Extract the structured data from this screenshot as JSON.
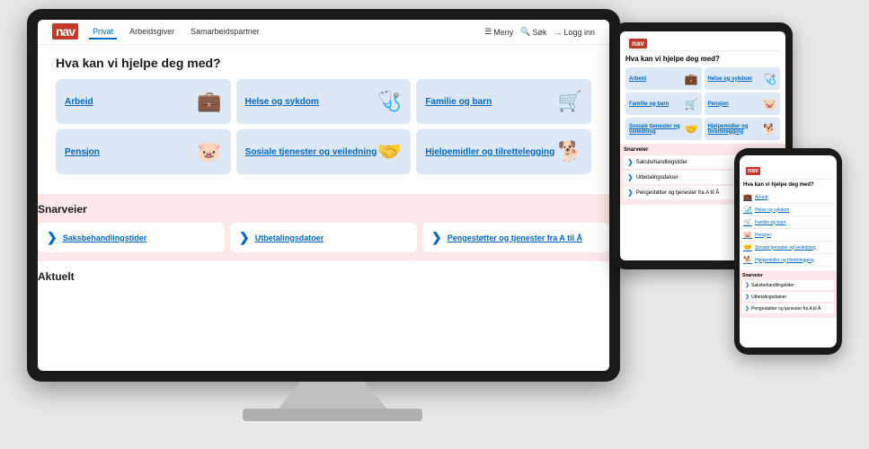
{
  "site": {
    "logo": "nav",
    "tabs": [
      {
        "label": "Privat",
        "active": true
      },
      {
        "label": "Arbeidsgiver",
        "active": false
      },
      {
        "label": "Samarbeidspartner",
        "active": false
      }
    ],
    "actions": [
      {
        "label": "Meny",
        "icon": "menu-icon"
      },
      {
        "label": "Søk",
        "icon": "search-icon"
      },
      {
        "label": "Logg inn",
        "icon": "login-icon"
      }
    ],
    "heading": "Hva kan vi hjelpe deg med?",
    "categories": [
      {
        "label": "Arbeid",
        "icon": "💼"
      },
      {
        "label": "Helse og sykdom",
        "icon": "🩺"
      },
      {
        "label": "Familie og barn",
        "icon": "🛒"
      },
      {
        "label": "Pensjon",
        "icon": "🐷"
      },
      {
        "label": "Sosiale tjenester og veiledning",
        "icon": "🤝"
      },
      {
        "label": "Hjelpemidler og tilrettelegging",
        "icon": "🐕"
      }
    ],
    "shortcuts_heading": "Snarveier",
    "shortcuts": [
      {
        "label": "Saksbehandlingstider"
      },
      {
        "label": "Utbetalingsdatoer"
      },
      {
        "label": "Pengestøtter og tjenester fra A til Å"
      }
    ],
    "aktuelt_heading": "Aktuelt"
  },
  "tablet": {
    "heading": "Hva kan vi hjelpe deg med?",
    "categories": [
      {
        "label": "Arbeid",
        "icon": "💼"
      },
      {
        "label": "Helse og sykdom",
        "icon": "🩺"
      },
      {
        "label": "Familie og barn",
        "icon": "🛒"
      },
      {
        "label": "Pensjon",
        "icon": "🐷"
      },
      {
        "label": "Sosiale tjenester og veiledning",
        "icon": "🤝"
      },
      {
        "label": "Hjelpemidler og tilrettelegging",
        "icon": "🐕"
      }
    ],
    "shortcuts_heading": "Snarveier",
    "shortcuts": [
      {
        "label": "Saksbehandlingstider"
      },
      {
        "label": "Utbetalingsdatoer"
      },
      {
        "label": "Pengestøtter og tjenester fra A til Å"
      }
    ]
  },
  "phone": {
    "heading": "Hva kan vi hjelpe deg med?",
    "list_items": [
      {
        "label": "Arbeid",
        "icon": "💼"
      },
      {
        "label": "Helse og sykdom",
        "icon": "🩺"
      },
      {
        "label": "Familie og barn",
        "icon": "🛒"
      },
      {
        "label": "Pensjon",
        "icon": "🐷"
      },
      {
        "label": "Sosiale tjenester og veiledning",
        "icon": "🤝"
      },
      {
        "label": "Hjelpemidler og tilrettelegging",
        "icon": "🐕"
      }
    ],
    "shortcuts_heading": "Snarveier",
    "shortcuts": [
      {
        "label": "Saksbehandlingstider"
      },
      {
        "label": "Utbetalingsdatoer"
      },
      {
        "label": "Pengestøtter og tjenester fra A til Å"
      }
    ]
  }
}
